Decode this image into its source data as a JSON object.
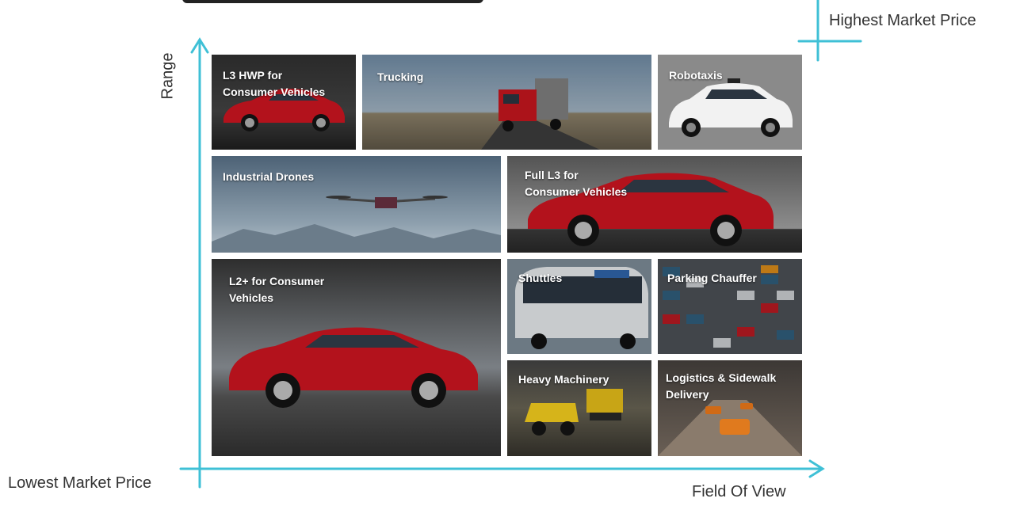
{
  "axis": {
    "y_label": "Range",
    "x_label": "Field Of View",
    "low_corner": "Lowest Market Price",
    "high_corner": "Highest Market Price",
    "color": "#3fc0d6"
  },
  "tiles": [
    {
      "id": "l3hwp",
      "label_lines": [
        "L3 HWP for",
        "Consumer Vehicles"
      ],
      "icon": "sedan-icon"
    },
    {
      "id": "trucking",
      "label_lines": [
        "Trucking"
      ],
      "icon": "truck-icon"
    },
    {
      "id": "robotaxis",
      "label_lines": [
        "Robotaxis"
      ],
      "icon": "suv-icon"
    },
    {
      "id": "drones",
      "label_lines": [
        "Industrial Drones"
      ],
      "icon": "drone-icon"
    },
    {
      "id": "fulll3",
      "label_lines": [
        "Full L3 for",
        "Consumer Vehicles"
      ],
      "icon": "sedan-icon"
    },
    {
      "id": "l2plus",
      "label_lines": [
        "L2+ for Consumer",
        "Vehicles"
      ],
      "icon": "sedan-icon"
    },
    {
      "id": "shuttles",
      "label_lines": [
        "Shuttles"
      ],
      "icon": "shuttle-icon"
    },
    {
      "id": "parking",
      "label_lines": [
        "Parking Chauffer"
      ],
      "icon": "parking-lot-icon"
    },
    {
      "id": "machinery",
      "label_lines": [
        "Heavy Machinery"
      ],
      "icon": "dump-truck-icon"
    },
    {
      "id": "logistics",
      "label_lines": [
        "Logistics & Sidewalk",
        "Delivery"
      ],
      "icon": "delivery-robot-icon"
    }
  ]
}
